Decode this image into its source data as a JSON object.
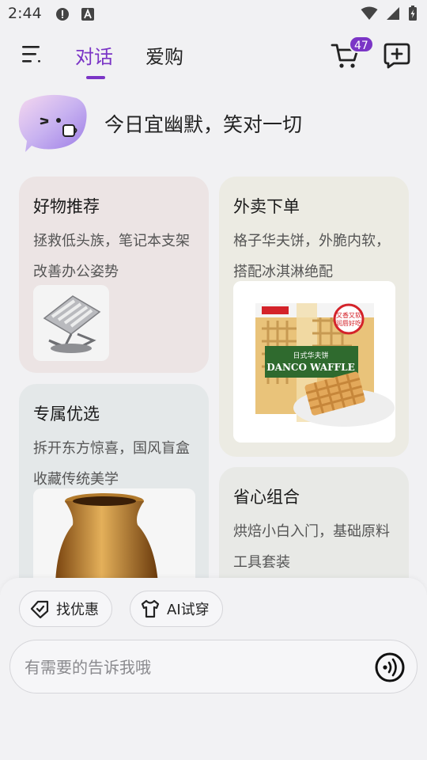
{
  "status_bar": {
    "time": "2:44"
  },
  "header": {
    "tabs": [
      {
        "label": "对话",
        "active": true
      },
      {
        "label": "爱购",
        "active": false
      }
    ],
    "cart_badge": "47",
    "accent_color": "#7b35c6"
  },
  "greeting": {
    "text": "今日宜幽默，笑对一切"
  },
  "cards": [
    {
      "title": "好物推荐",
      "desc": "拯救低头族，笔记本支架改善办公姿势",
      "image": "laptop-stand"
    },
    {
      "title": "外卖下单",
      "desc": "格子华夫饼，外脆内软，搭配冰淇淋绝配",
      "image": "waffle-package"
    },
    {
      "title": "专属优选",
      "desc": "拆开东方惊喜，国风盲盒收藏传统美学",
      "image": "bronze-vase"
    },
    {
      "title": "省心组合",
      "desc": "烘焙小白入门，基础原料工具套装",
      "image": "baking-kit"
    }
  ],
  "waffle_package": {
    "brand": "DANCO WAFFLE",
    "tagline": "日式华夫饼",
    "stamp": "又香又软 润唇好吃"
  },
  "chips": [
    {
      "label": "找优惠",
      "icon": "coupon-icon"
    },
    {
      "label": "AI试穿",
      "icon": "tshirt-icon"
    }
  ],
  "input": {
    "placeholder": "有需要的告诉我哦"
  }
}
